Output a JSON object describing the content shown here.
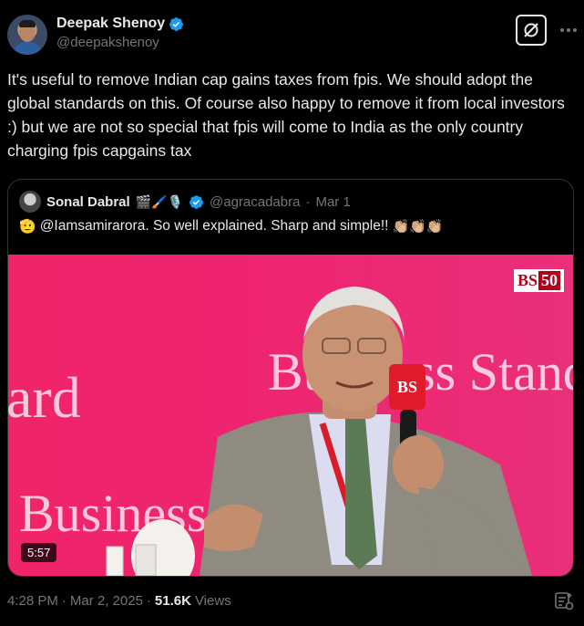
{
  "author": {
    "display_name": "Deepak Shenoy",
    "handle": "@deepakshenoy"
  },
  "tweet": {
    "text": "It's useful to remove Indian cap gains taxes from fpis. We should adopt the global standards on this. Of course also happy to remove it from local investors :) but we are not so special that fpis will come to India as the only country charging fpis capgains tax"
  },
  "quote": {
    "display_name": "Sonal Dabral",
    "name_emojis": "🎬🖌️🎙️",
    "handle": "@agracadabra",
    "separator": "·",
    "date": "Mar 1",
    "text_emoji_start": "🫡",
    "text": "@Iamsamirarora. So well explained. Sharp and simple!!",
    "text_emoji_end": "👏🏼👏🏼👏🏼",
    "video": {
      "duration": "5:57",
      "logo_text": "BS",
      "logo_num": "50",
      "backdrop_words": [
        "ard",
        "Business Standard",
        "Business St"
      ],
      "mic_label": "BS"
    }
  },
  "meta": {
    "time": "4:28 PM",
    "dot1": "·",
    "date": "Mar 2, 2025",
    "dot2": "·",
    "views_count": "51.6K",
    "views_label": "Views"
  },
  "colors": {
    "verified": "#1d9bf0",
    "background": "#000000",
    "text_primary": "#e7e9ea",
    "text_secondary": "#71767b",
    "video_bg": "#ee2470"
  }
}
